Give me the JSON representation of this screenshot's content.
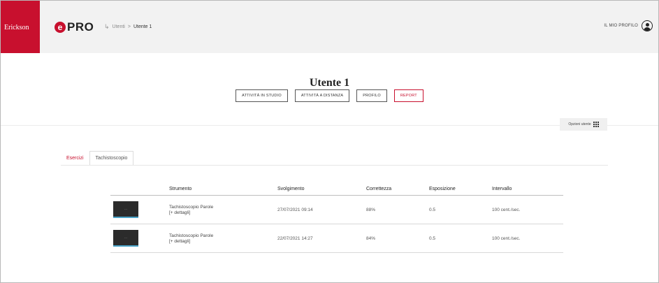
{
  "header": {
    "brand": "Erickson",
    "app_logo_letter": "e",
    "app_logo_text": "PRO",
    "breadcrumb": {
      "parent": "Utenti",
      "separator": ">",
      "current": "Utente 1"
    },
    "profile_label": "IL MIO PROFILO"
  },
  "page": {
    "title": "Utente 1",
    "buttons": [
      {
        "label": "ATTIVITÀ IN STUDIO",
        "active": false
      },
      {
        "label": "ATTIVITÀ A DISTANZA",
        "active": false
      },
      {
        "label": "PROFILO",
        "active": false
      },
      {
        "label": "REPORT",
        "active": true
      }
    ],
    "user_options_label": "Opzioni utente"
  },
  "tabs": [
    {
      "label": "Esercizi",
      "active": false
    },
    {
      "label": "Tachistoscopio",
      "active": true
    }
  ],
  "table": {
    "columns": [
      "Strumento",
      "Svolgimento",
      "Correttezza",
      "Esposizione",
      "Intervallo"
    ],
    "rows": [
      {
        "strumento": "Tachistoscopio Parole",
        "details": "[+ dettagli]",
        "svolgimento": "27/07/2021 09:14",
        "correttezza": "88%",
        "esposizione": "0.5",
        "intervallo": "100 cent./sec."
      },
      {
        "strumento": "Tachistoscopio Parole",
        "details": "[+ dettagli]",
        "svolgimento": "22/07/2021 14:27",
        "correttezza": "84%",
        "esposizione": "0.5",
        "intervallo": "100 cent./sec."
      }
    ]
  },
  "colors": {
    "brand_red": "#c8102e",
    "topbar_bg": "#f2f2f2",
    "thumb_accent": "#4aa3c8"
  }
}
